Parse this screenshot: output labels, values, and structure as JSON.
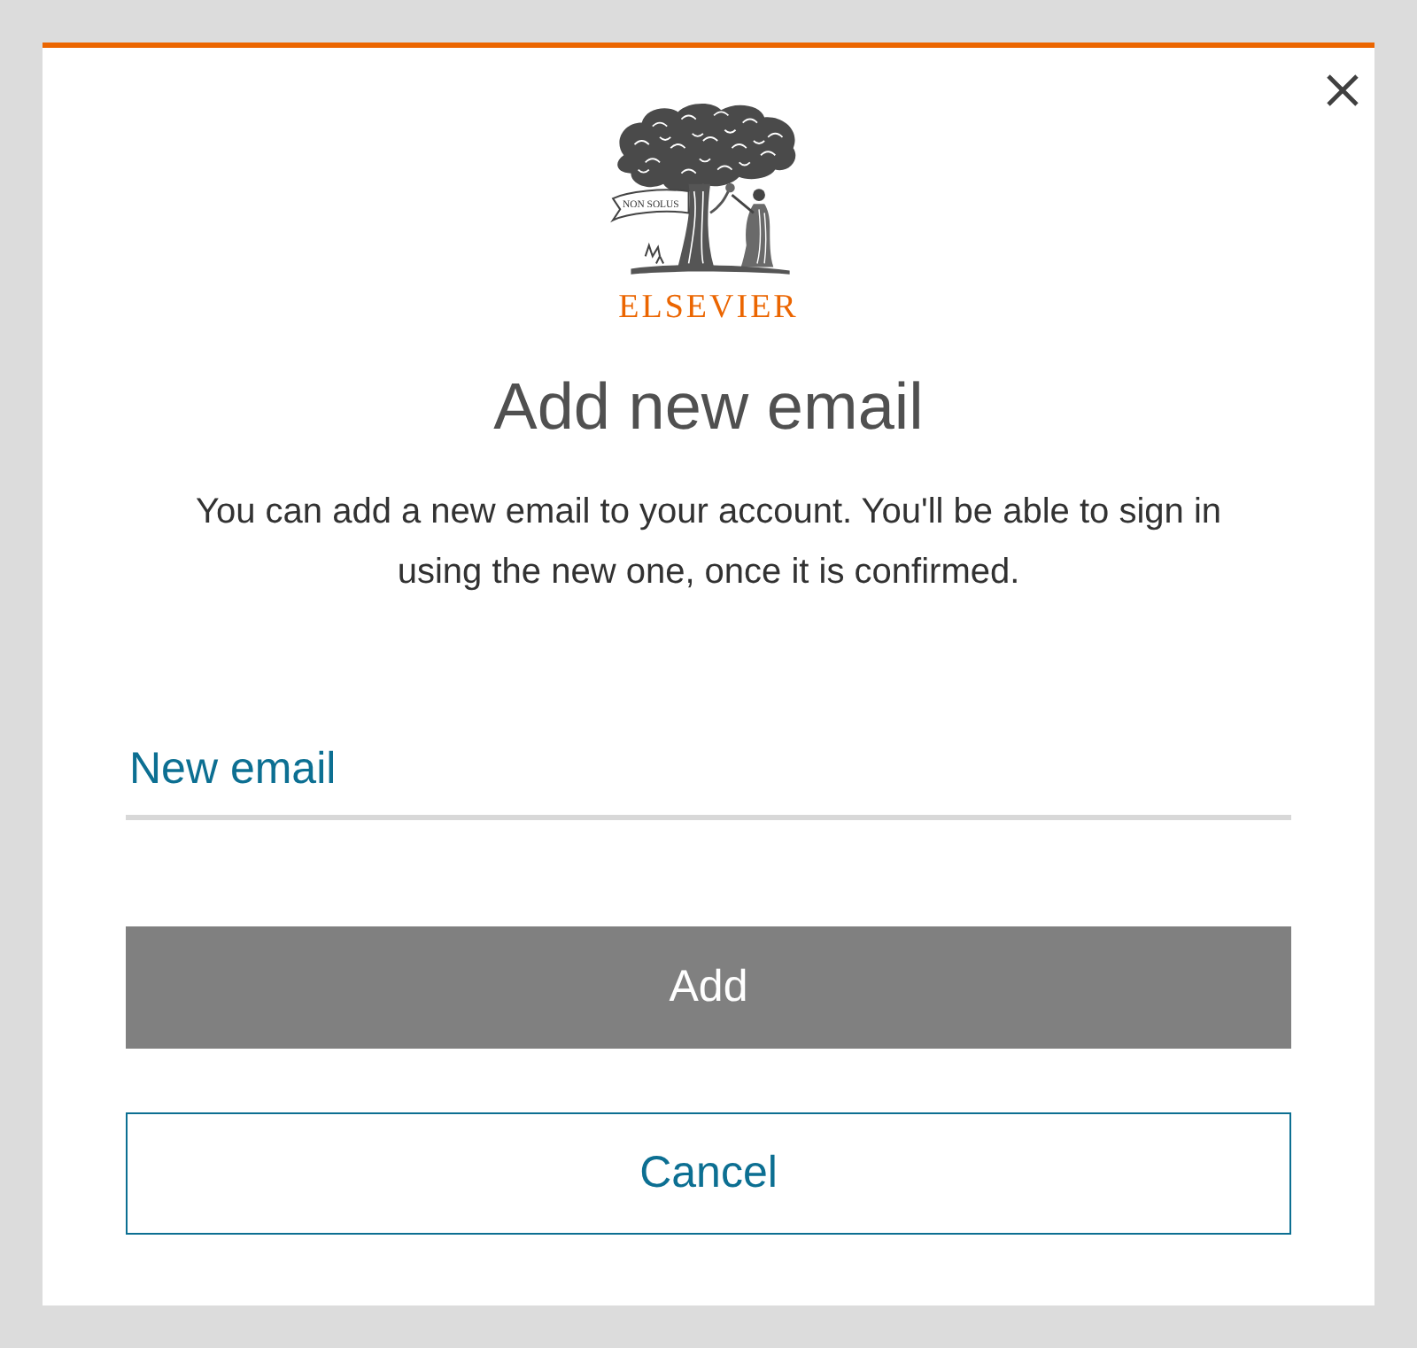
{
  "logo": {
    "motto": "NON SOLUS",
    "wordmark": "ELSEVIER"
  },
  "dialog": {
    "title": "Add new email",
    "description": "You can add a new email to your account. You'll be able to sign in using the new one, once it is confirmed."
  },
  "email_field": {
    "placeholder": "New email"
  },
  "buttons": [
    {
      "label": "Add",
      "kind": "primary",
      "disabled": true
    },
    {
      "label": "Cancel",
      "kind": "secondary",
      "disabled": false
    }
  ]
}
